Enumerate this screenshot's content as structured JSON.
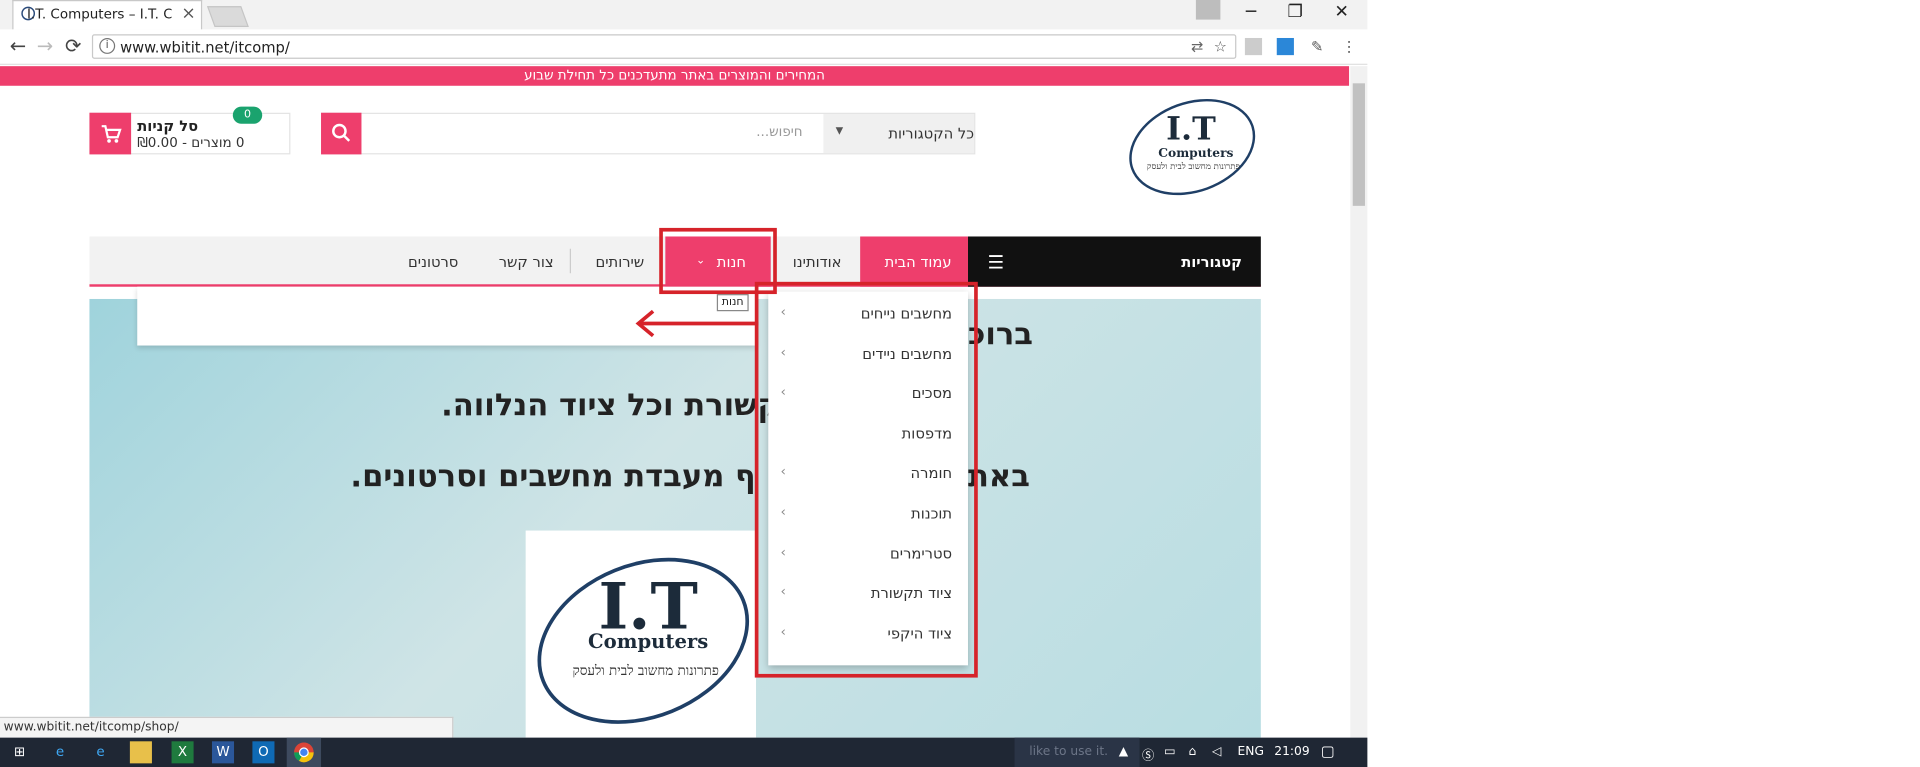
{
  "browser": {
    "tab_title": "I.T. Computers – I.T. Com",
    "tab_close": "×",
    "url": "www.wbitit.net/itcomp/",
    "back": "←",
    "forward": "→",
    "reload": "⟳",
    "info": "i",
    "window_minimize": "─",
    "window_restore": "❐",
    "window_close": "✕",
    "ext_translate": "⇄",
    "ext_star": "☆",
    "ext_menu": "⋮"
  },
  "page": {
    "promo_text": "המחירים והמוצרים באתר מתעדכנים כל תחילת שבוע",
    "logo": {
      "main": "I.T",
      "sub": "Computers",
      "tagline": "פתרונות מחשוב לבית ולעסק"
    },
    "search": {
      "placeholder": "חיפוש...",
      "category": "כל הקטגוריות"
    },
    "cart": {
      "title": "סל קניות",
      "summary": "0 מוצרים - ₪0.00",
      "count": "0"
    },
    "menu": {
      "categories": "קטגוריות",
      "home": "עמוד הבית",
      "about": "אודותינו",
      "shop": "חנות",
      "services": "שירותים",
      "contact": "צור קשר",
      "videos": "סרטונים"
    },
    "tooltip": "חנות",
    "hero": {
      "line1": "ברוכ",
      "line2": "קשורת וכל ציוד הנלווה.",
      "line3a": "באת",
      "line3b": "ף מעבדת מחשבים וסרטונים."
    },
    "dropdown": [
      {
        "label": "מחשבים נייחים",
        "has_sub": true
      },
      {
        "label": "מחשבים ניידים",
        "has_sub": true
      },
      {
        "label": "מסכים",
        "has_sub": true
      },
      {
        "label": "מדפסות",
        "has_sub": false
      },
      {
        "label": "חומרה",
        "has_sub": true
      },
      {
        "label": "תוכנות",
        "has_sub": true
      },
      {
        "label": "סטרימרים",
        "has_sub": true
      },
      {
        "label": "ציוד תקשורת",
        "has_sub": true
      },
      {
        "label": "ציוד היקפי",
        "has_sub": true
      }
    ],
    "status_url": "www.wbitit.net/itcomp/shop/"
  },
  "taskbar": {
    "time": "21:09",
    "lang": "ENG",
    "toast": "like to use it."
  },
  "colors": {
    "accent": "#ee3e6c",
    "annotation": "#d6232a",
    "badge": "#1aa36e"
  }
}
